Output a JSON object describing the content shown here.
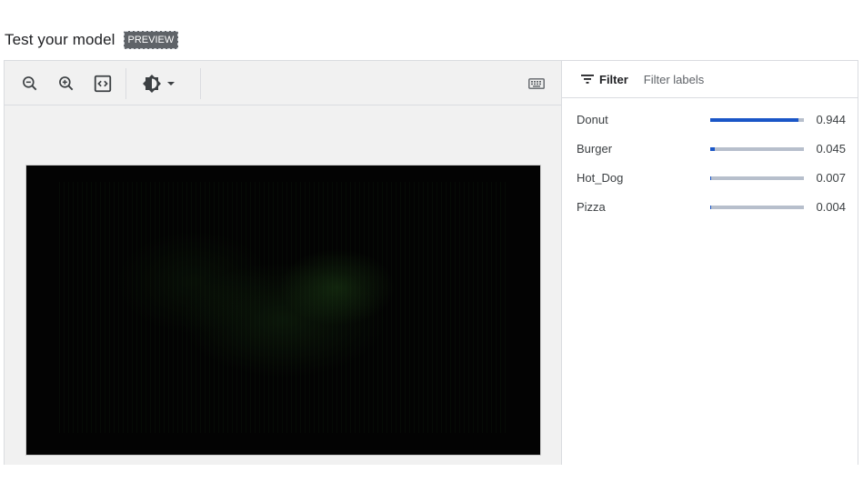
{
  "header": {
    "title": "Test your model",
    "badge": "PREVIEW"
  },
  "toolbar": {
    "buttons": [
      {
        "name": "zoom-out-icon"
      },
      {
        "name": "zoom-in-icon"
      },
      {
        "name": "fit-screen-icon"
      },
      {
        "name": "brightness-icon"
      }
    ],
    "keyboard": "keyboard-icon"
  },
  "filter": {
    "label": "Filter",
    "placeholder": "Filter labels"
  },
  "predictions": [
    {
      "label": "Donut",
      "score": "0.944",
      "fraction": 0.944
    },
    {
      "label": "Burger",
      "score": "0.045",
      "fraction": 0.045
    },
    {
      "label": "Hot_Dog",
      "score": "0.007",
      "fraction": 0.007
    },
    {
      "label": "Pizza",
      "score": "0.004",
      "fraction": 0.004
    }
  ],
  "colors": {
    "accent": "#1a56c7",
    "track": "#b7bfcc",
    "canvas_bg": "#f1f1f1"
  }
}
